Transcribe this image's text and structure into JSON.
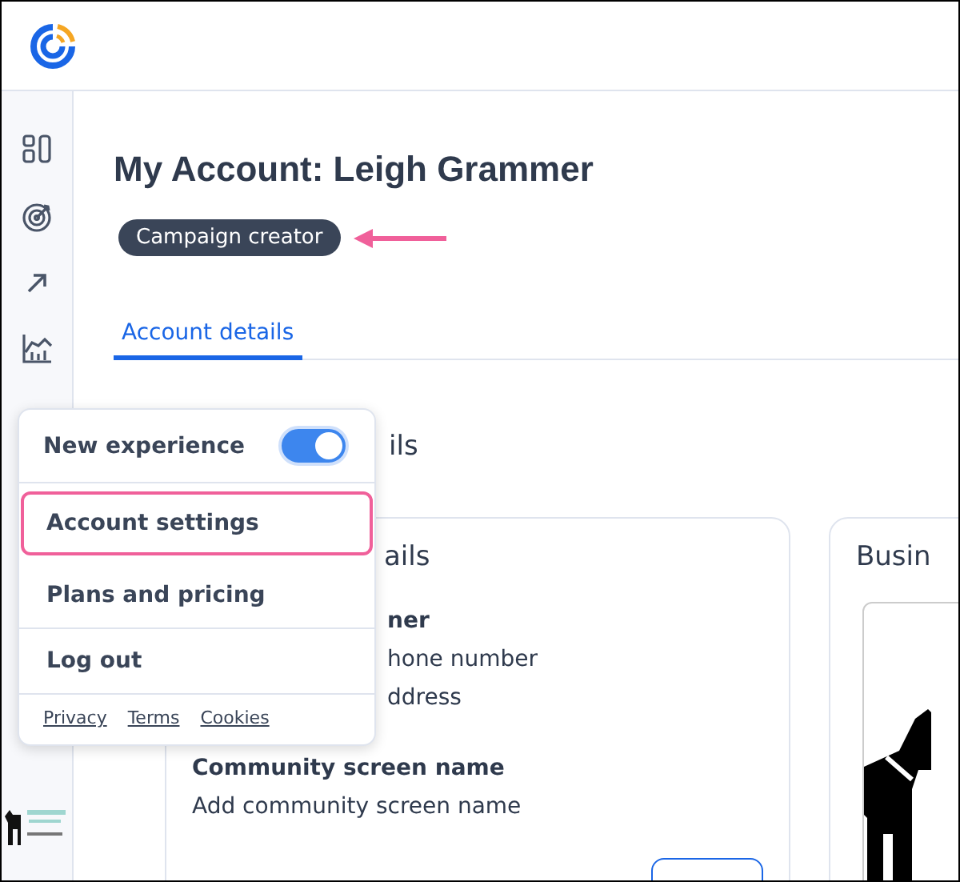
{
  "page": {
    "title": "My Account: Leigh Grammer",
    "role_badge": "Campaign creator"
  },
  "tabs": [
    {
      "label": "Account details",
      "selected": true
    }
  ],
  "section_heading": "ils",
  "cards": [
    {
      "kind": "details",
      "title": "ails",
      "lines": [
        {
          "text": "ner",
          "bold": true
        },
        {
          "text": "hone number",
          "bold": false
        },
        {
          "text": "ddress",
          "bold": false
        }
      ],
      "fields": [
        {
          "label": "Community screen name",
          "value": "Add community screen name"
        }
      ]
    },
    {
      "kind": "logo",
      "title": "Busin"
    }
  ],
  "menu": {
    "toggle": {
      "label": "New experience",
      "on": true
    },
    "items": [
      {
        "label": "Account settings",
        "highlighted": true
      },
      {
        "label": "Plans and pricing",
        "highlighted": false
      },
      {
        "label": "Log out",
        "highlighted": false
      }
    ],
    "links": [
      "Privacy",
      "Terms",
      "Cookies"
    ]
  }
}
